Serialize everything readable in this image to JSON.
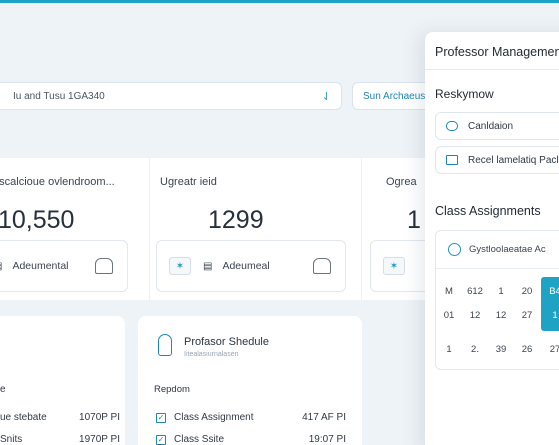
{
  "search": {
    "value": "Iu and Tusu 1GA340",
    "button_label": "Sun Archaeus"
  },
  "stats": [
    {
      "label": "Inscalcioue ovlendroom...",
      "value": "10,550",
      "foot_label": "Adeumental"
    },
    {
      "label": "Ugreatr ieid",
      "value": "1299",
      "foot_label": "Adeumeal"
    },
    {
      "label": "Ogrea",
      "value": "1"
    }
  ],
  "card_a": {
    "section": "e",
    "rows": [
      {
        "label": "ue stebate",
        "time": "1070P PI"
      },
      {
        "label": "Snits",
        "time": "1970P PI"
      }
    ]
  },
  "card_b": {
    "title": "Profasor Shedule",
    "subtitle": "Iitealasiurnalasen",
    "section": "Repdom",
    "rows": [
      {
        "label": "Class Assignment",
        "time": "417 AF PI"
      },
      {
        "label": "Class Ssite",
        "time": "19:07 PI"
      }
    ]
  },
  "panel": {
    "title": "Professor Management",
    "section1": "Reskymow",
    "items": [
      {
        "label": "Canldaion"
      },
      {
        "label": "Recel lamelatiq Pacle"
      }
    ],
    "section2": "Class Assignments",
    "calendar": {
      "header": "Gystloolaeatae Ac",
      "rows": [
        [
          "M",
          "612",
          "1",
          "20",
          "B4"
        ],
        [
          "01",
          "12",
          "12",
          "27",
          "1"
        ],
        [
          "1",
          "2.",
          "39",
          "26",
          "27"
        ]
      ],
      "highlight_col": 4
    }
  }
}
